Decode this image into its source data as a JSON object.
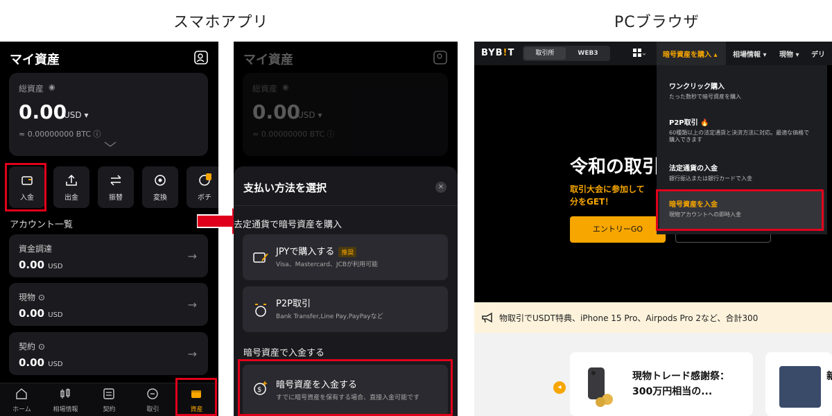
{
  "captions": {
    "mobile": "スマホアプリ",
    "pc": "PCブラウザ"
  },
  "mobile_left": {
    "title": "マイ資産",
    "total_label": "総資産",
    "total_value": "0.00",
    "total_unit": "USD ▾",
    "btc_value": "≈ 0.00000000 BTC ⓘ",
    "actions": [
      {
        "label": "入金",
        "icon": "deposit-icon"
      },
      {
        "label": "出金",
        "icon": "withdraw-icon"
      },
      {
        "label": "振替",
        "icon": "transfer-icon"
      },
      {
        "label": "変換",
        "icon": "convert-icon"
      },
      {
        "label": "ボチ",
        "icon": "bot-icon"
      }
    ],
    "account_section": "アカウント一覧",
    "accounts": [
      {
        "name": "資金調達",
        "value": "0.00",
        "unit": "USD"
      },
      {
        "name": "現物 ⊙",
        "value": "0.00",
        "unit": "USD"
      },
      {
        "name": "契約 ⊙",
        "value": "0.00",
        "unit": "USD"
      }
    ],
    "tabs": [
      {
        "label": "ホーム",
        "icon": "home-icon"
      },
      {
        "label": "相場情報",
        "icon": "candlestick-icon"
      },
      {
        "label": "契約",
        "icon": "contract-icon"
      },
      {
        "label": "取引",
        "icon": "trade-icon"
      },
      {
        "label": "資産",
        "icon": "wallet-icon"
      }
    ]
  },
  "mobile_right": {
    "title": "マイ資産",
    "total_label": "総資産",
    "total_value": "0.00",
    "total_unit": "USD ▾",
    "btc_value": "≈ 0.00000000 BTC ⓘ",
    "sheet_title": "支払い方法を選択",
    "close_icon": "×",
    "fiat_section": "法定通貨で暗号資産を購入",
    "fiat_section_visible": "去定通貨で暗号資産を購入",
    "options": [
      {
        "title": "JPYで購入する",
        "badge": "推奨",
        "desc": "Visa、Mastercard、JCBが利用可能"
      },
      {
        "title": "P2P取引",
        "badge": "",
        "desc": "Bank Transfer,Line Pay,PayPayなど"
      }
    ],
    "crypto_section": "暗号資産で入金する",
    "crypto_option": {
      "title": "暗号資産を入金する",
      "desc": "すでに暗号資産を保有する場合、直接入金可能です"
    }
  },
  "pc": {
    "logo": "BYB",
    "logo_i": "!",
    "logo_t": "T",
    "seg_exchange": "取引所",
    "seg_web3": "WEB3",
    "nav_buy": "暗号資産を購入 ▴",
    "nav_market": "相場情報 ▾",
    "nav_spot": "現物 ▾",
    "nav_deri": "デリ",
    "dropdown": [
      {
        "title": "ワンクリック購入",
        "desc": "たった数秒で暗号資産を購入"
      },
      {
        "title": "P2P取引 🔥",
        "desc": "60種類以上の法定通貨と決済方法に対応。最適な価格で購入できます"
      },
      {
        "title": "法定通貨の入金",
        "desc": "銀行振込または銀行カードで入金"
      },
      {
        "title": "暗号資産を入金",
        "desc": "現物アカウントへの即時入金"
      }
    ],
    "hero_title": "令和の取引",
    "hero_sub": "取引大会に参加して 分をGET！",
    "entry_button": "エントリーGO",
    "ticker": "物取引でUSDT特典、iPhone 15 Pro、Airpods Pro 2など、合計300",
    "promo_title": "現物トレード感謝祭：300万円相当の...",
    "promo2_title": "新"
  },
  "colors": {
    "accent": "#f7a600",
    "highlight": "#e0001b",
    "bg": "#000000"
  }
}
